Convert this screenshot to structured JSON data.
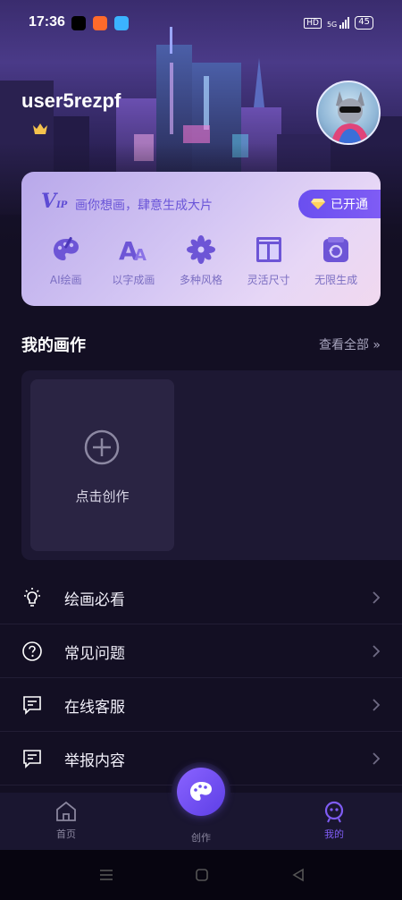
{
  "status_bar": {
    "time": "17:36",
    "battery": "45",
    "hd": "HD",
    "net": "5G"
  },
  "user": {
    "name": "user5rezpf"
  },
  "vip": {
    "logo": "V",
    "logo_small": "IP",
    "slogan": "画你想画，肆意生成大片",
    "status_button": "已开通",
    "features": [
      {
        "label": "AI绘画",
        "icon": "palette-icon"
      },
      {
        "label": "以字成画",
        "icon": "text-aa-icon"
      },
      {
        "label": "多种风格",
        "icon": "flower-icon"
      },
      {
        "label": "灵活尺寸",
        "icon": "layout-icon"
      },
      {
        "label": "无限生成",
        "icon": "infinite-icon"
      }
    ]
  },
  "works": {
    "title": "我的画作",
    "view_all": "查看全部",
    "create_label": "点击创作"
  },
  "menu": [
    {
      "label": "绘画必看",
      "icon": "lightbulb-icon"
    },
    {
      "label": "常见问题",
      "icon": "question-circle-icon"
    },
    {
      "label": "在线客服",
      "icon": "chat-icon"
    },
    {
      "label": "举报内容",
      "icon": "report-icon"
    }
  ],
  "bottom_nav": {
    "home": "首页",
    "create": "创作",
    "mine": "我的"
  },
  "colors": {
    "accent": "#7f5cf4",
    "background": "#130f23",
    "vip_text": "#6a55d8"
  }
}
